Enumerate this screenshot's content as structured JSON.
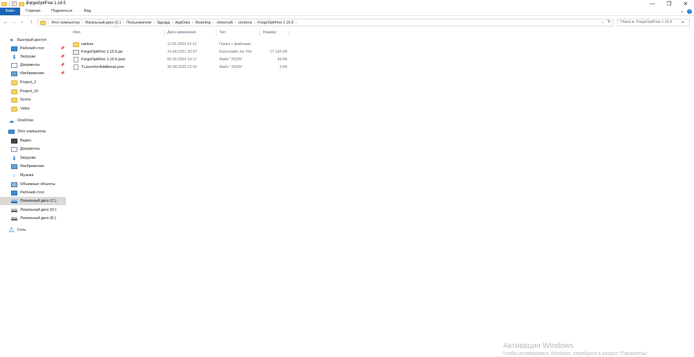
{
  "window": {
    "title": "ForgeOptiFine 1.16.5",
    "minimize": "—",
    "maximize": "❐",
    "close": "✕"
  },
  "ribbon": {
    "tabs": [
      "Файл",
      "Главная",
      "Поделиться",
      "Вид"
    ],
    "expand_glyph": "⌄",
    "help_glyph": "?"
  },
  "address": {
    "back": "←",
    "forward": "→",
    "recent": "⌄",
    "up": "↑",
    "separator": "›",
    "crumbs": [
      "Этот компьютер",
      "Локальный диск (C:)",
      "Пользователи",
      "Эдуард",
      "AppData",
      "Roaming",
      ".minecraft",
      "versions",
      "ForgeOptiFine 1.16.5"
    ],
    "dropdown_glyph": "⌄",
    "refresh_glyph": "↻"
  },
  "search": {
    "placeholder": "Поиск в: ForgeOptiFine 1.16.5",
    "icon": "⌕"
  },
  "nav": {
    "quick_access": {
      "label": "Быстрый доступ",
      "icon": "star-icon"
    },
    "pinned": [
      {
        "label": "Рабочий стол",
        "icon": "desktop-icon",
        "pin": "📌"
      },
      {
        "label": "Загрузки",
        "icon": "downloads-icon",
        "pin": "📌"
      },
      {
        "label": "Документы",
        "icon": "documents-icon",
        "pin": "📌"
      },
      {
        "label": "Изображения",
        "icon": "pictures-icon",
        "pin": "📌"
      }
    ],
    "folders": [
      {
        "label": "Project_2"
      },
      {
        "label": "Project_10"
      },
      {
        "label": "Scrins"
      },
      {
        "label": "Video"
      }
    ],
    "onedrive": "OneDrive",
    "this_pc": "Этот компьютер",
    "pc_items": [
      {
        "label": "Видео"
      },
      {
        "label": "Документы"
      },
      {
        "label": "Загрузки"
      },
      {
        "label": "Изображения"
      },
      {
        "label": "Музыка"
      },
      {
        "label": "Объемные объекты"
      },
      {
        "label": "Рабочий стол"
      },
      {
        "label": "Локальный диск (C:)",
        "selected": true
      },
      {
        "label": "Локальный диск (D:)"
      },
      {
        "label": "Локальный диск (E:)"
      }
    ],
    "network": "Сеть"
  },
  "columns": {
    "name": "Имя",
    "date": "Дата изменения",
    "type": "Тип",
    "size": "Размер",
    "sort_glyph": "^"
  },
  "files": [
    {
      "name": "natives",
      "date": "11.06.2023 01:12",
      "type": "Папка с файлами",
      "size": "",
      "kind": "folder"
    },
    {
      "name": "ForgeOptiFine 1.16.5.jar",
      "date": "14.08.2021 20:57",
      "type": "Executable Jar File",
      "size": "17 136 КБ",
      "kind": "jar"
    },
    {
      "name": "ForgeOptiFine 1.16.5.json",
      "date": "05.05.2024 16:17",
      "type": "Файл \"JSON\"",
      "size": "49 КБ",
      "kind": "file"
    },
    {
      "name": "TLauncherAdditional.json",
      "date": "26.08.2025 22:52",
      "type": "Файл \"JSON\"",
      "size": "3 КБ",
      "kind": "file"
    }
  ],
  "watermark": {
    "title": "Активация Windows",
    "subtitle": "Чтобы активировать Windows, перейдите в раздел \"Параметры\"."
  }
}
